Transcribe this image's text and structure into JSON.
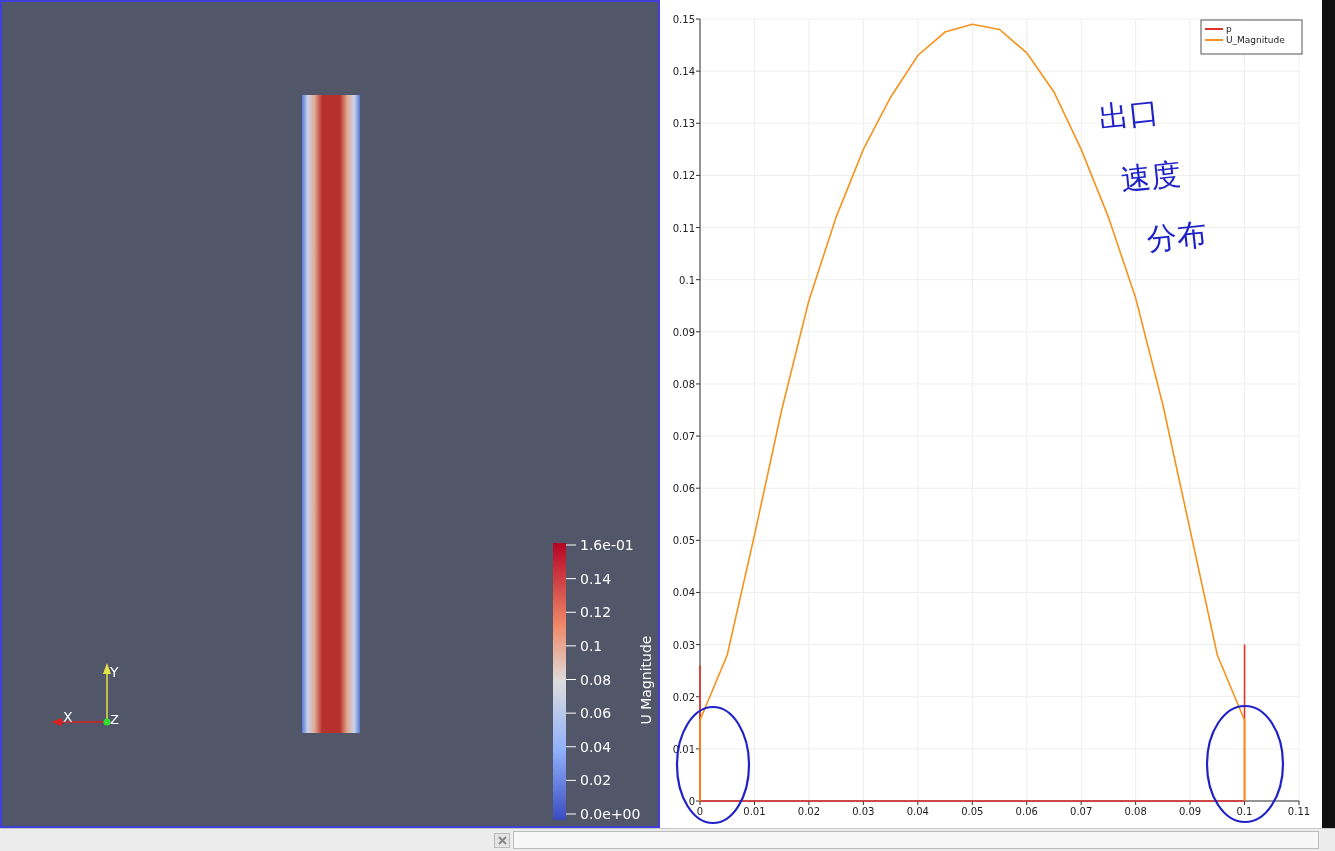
{
  "render_view": {
    "color_legend": {
      "title": "U Magnitude",
      "labels": [
        "1.6e-01",
        "0.14",
        "0.12",
        "0.1",
        "0.08",
        "0.06",
        "0.04",
        "0.02",
        "0.0e+00"
      ]
    },
    "orientation_axes": {
      "x_label": "X",
      "y_label": "Y",
      "z_label": "Z"
    }
  },
  "chart_view": {
    "chart_data": {
      "type": "line",
      "x": [
        0,
        0,
        0.005,
        0.01,
        0.015,
        0.02,
        0.025,
        0.03,
        0.035,
        0.04,
        0.045,
        0.05,
        0.055,
        0.06,
        0.065,
        0.07,
        0.075,
        0.08,
        0.085,
        0.09,
        0.095,
        0.1,
        0.1
      ],
      "series": [
        {
          "name": "p",
          "color": "#e0312b",
          "values": [
            0.026,
            0,
            0,
            0,
            0,
            0,
            0,
            0,
            0,
            0,
            0,
            0,
            0,
            0,
            0,
            0,
            0,
            0,
            0,
            0,
            0,
            0,
            0.03
          ]
        },
        {
          "name": "U_Magnitude",
          "color": "#f5931e",
          "values": [
            0,
            0.0155,
            0.028,
            0.051,
            0.075,
            0.096,
            0.112,
            0.125,
            0.135,
            0.143,
            0.1475,
            0.149,
            0.148,
            0.1435,
            0.136,
            0.125,
            0.112,
            0.0965,
            0.076,
            0.052,
            0.028,
            0.0155,
            0
          ]
        }
      ],
      "grid": true,
      "legend": true,
      "xlim": [
        0,
        0.11
      ],
      "ylim": [
        0,
        0.15
      ],
      "xticks": [
        {
          "value": 0,
          "label": "0"
        },
        {
          "value": 0.01,
          "label": "0.01"
        },
        {
          "value": 0.02,
          "label": "0.02"
        },
        {
          "value": 0.03,
          "label": "0.03"
        },
        {
          "value": 0.04,
          "label": "0.04"
        },
        {
          "value": 0.05,
          "label": "0.05"
        },
        {
          "value": 0.06,
          "label": "0.06"
        },
        {
          "value": 0.07,
          "label": "0.07"
        },
        {
          "value": 0.08,
          "label": "0.08"
        },
        {
          "value": 0.09,
          "label": "0.09"
        },
        {
          "value": 0.1,
          "label": "0.1"
        },
        {
          "value": 0.11,
          "label": "0.11"
        }
      ],
      "yticks": [
        {
          "value": 0,
          "label": "0"
        },
        {
          "value": 0.01,
          "label": "0.01"
        },
        {
          "value": 0.02,
          "label": "0.02"
        },
        {
          "value": 0.03,
          "label": "0.03"
        },
        {
          "value": 0.04,
          "label": "0.04"
        },
        {
          "value": 0.05,
          "label": "0.05"
        },
        {
          "value": 0.06,
          "label": "0.06"
        },
        {
          "value": 0.07,
          "label": "0.07"
        },
        {
          "value": 0.08,
          "label": "0.08"
        },
        {
          "value": 0.09,
          "label": "0.09"
        },
        {
          "value": 0.1,
          "label": "0.1"
        },
        {
          "value": 0.11,
          "label": "0.11"
        },
        {
          "value": 0.12,
          "label": "0.12"
        },
        {
          "value": 0.13,
          "label": "0.13"
        },
        {
          "value": 0.14,
          "label": "0.14"
        },
        {
          "value": 0.15,
          "label": "0.15"
        }
      ]
    }
  },
  "handwritten_notes": [
    "出口",
    "速度",
    "分布"
  ]
}
